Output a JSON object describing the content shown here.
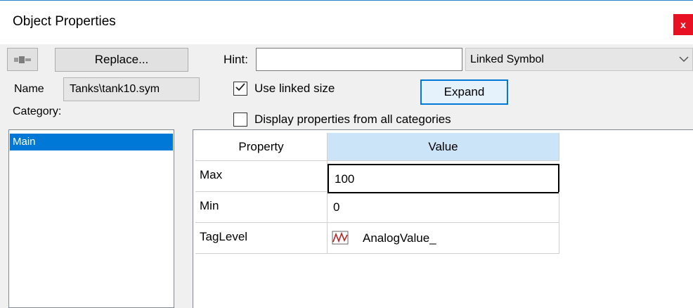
{
  "window": {
    "title": "Object Properties",
    "close_label": "x"
  },
  "toolbar": {
    "replace_label": "Replace...",
    "hint_label": "Hint:",
    "hint_value": "",
    "symbol_select_value": "Linked Symbol"
  },
  "name": {
    "label": "Name",
    "value": "Tanks\\tank10.sym"
  },
  "options": {
    "use_linked_size": {
      "label": "Use linked size",
      "checked": true
    },
    "display_all": {
      "label": "Display properties from all categories",
      "checked": false
    },
    "expand_label": "Expand"
  },
  "category": {
    "label": "Category:",
    "items": [
      "Main"
    ],
    "selected": "Main"
  },
  "grid": {
    "headers": [
      "Property",
      "Value"
    ],
    "rows": [
      {
        "property": "Max",
        "value": "100"
      },
      {
        "property": "Min",
        "value": "0"
      },
      {
        "property": "TagLevel",
        "value": "AnalogValue_",
        "icon": "analog-tag-icon"
      }
    ]
  },
  "colors": {
    "selection": "#0078d7",
    "header_highlight": "#cce4f7",
    "close": "#e81123",
    "focus_border": "#0078d7"
  }
}
